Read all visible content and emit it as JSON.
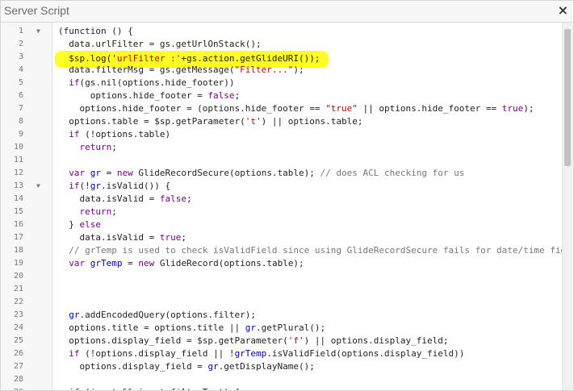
{
  "window": {
    "title": "Server Script",
    "close_icon": "×"
  },
  "lines": [
    {
      "n": "1",
      "fold": "▼",
      "segs": [
        [
          "",
          "(function () {"
        ]
      ]
    },
    {
      "n": "2",
      "fold": "",
      "segs": [
        [
          "",
          "  data.urlFilter = gs.getUrlOnStack();"
        ]
      ]
    },
    {
      "n": "3",
      "fold": "",
      "highlight": true,
      "segs": [
        [
          "",
          "  $sp.log("
        ],
        [
          "str",
          "'urlFilter :'"
        ],
        [
          "",
          "+gs.action.getGlideURI());"
        ]
      ]
    },
    {
      "n": "4",
      "fold": "",
      "segs": [
        [
          "",
          "  data.filterMsg = gs.getMessage("
        ],
        [
          "str",
          "\"Filter...\""
        ],
        [
          "",
          ");"
        ]
      ]
    },
    {
      "n": "5",
      "fold": "",
      "segs": [
        [
          "",
          "  "
        ],
        [
          "kw",
          "if"
        ],
        [
          "",
          "(gs.nil(options.hide_footer))"
        ]
      ]
    },
    {
      "n": "6",
      "fold": "",
      "segs": [
        [
          "",
          "      options.hide_footer = "
        ],
        [
          "kw",
          "false"
        ],
        [
          "",
          ";"
        ]
      ]
    },
    {
      "n": "7",
      "fold": "",
      "segs": [
        [
          "",
          "    options.hide_footer = (options.hide_footer == "
        ],
        [
          "str",
          "\"true\""
        ],
        [
          "",
          " || options.hide_footer == "
        ],
        [
          "kw",
          "true"
        ],
        [
          "",
          ");"
        ]
      ]
    },
    {
      "n": "8",
      "fold": "",
      "segs": [
        [
          "",
          "  options.table = $sp.getParameter("
        ],
        [
          "str",
          "'t'"
        ],
        [
          "",
          ") || options.table;"
        ]
      ]
    },
    {
      "n": "9",
      "fold": "",
      "segs": [
        [
          "",
          "  "
        ],
        [
          "kw",
          "if"
        ],
        [
          "",
          " (!options.table)"
        ]
      ]
    },
    {
      "n": "10",
      "fold": "",
      "segs": [
        [
          "",
          "    "
        ],
        [
          "kw",
          "return"
        ],
        [
          "",
          ";"
        ]
      ]
    },
    {
      "n": "11",
      "fold": "",
      "segs": [
        [
          "",
          ""
        ]
      ]
    },
    {
      "n": "12",
      "fold": "",
      "segs": [
        [
          "",
          "  "
        ],
        [
          "kw",
          "var"
        ],
        [
          "",
          " "
        ],
        [
          "vr",
          "gr"
        ],
        [
          "",
          " = "
        ],
        [
          "kw",
          "new"
        ],
        [
          "",
          " GlideRecordSecure(options.table); "
        ],
        [
          "cm",
          "// does ACL checking for us"
        ]
      ]
    },
    {
      "n": "13",
      "fold": "▼",
      "segs": [
        [
          "",
          "  "
        ],
        [
          "kw",
          "if"
        ],
        [
          "",
          "(!"
        ],
        [
          "vr",
          "gr"
        ],
        [
          "",
          ".isValid()) {"
        ]
      ]
    },
    {
      "n": "14",
      "fold": "",
      "segs": [
        [
          "",
          "    data.isValid = "
        ],
        [
          "kw",
          "false"
        ],
        [
          "",
          ";"
        ]
      ]
    },
    {
      "n": "15",
      "fold": "",
      "segs": [
        [
          "",
          "    "
        ],
        [
          "kw",
          "return"
        ],
        [
          "",
          ";"
        ]
      ]
    },
    {
      "n": "16",
      "fold": "",
      "segs": [
        [
          "",
          "  } "
        ],
        [
          "kw",
          "else"
        ]
      ]
    },
    {
      "n": "17",
      "fold": "",
      "segs": [
        [
          "",
          "    data.isValid = "
        ],
        [
          "kw",
          "true"
        ],
        [
          "",
          ";"
        ]
      ]
    },
    {
      "n": "18",
      "fold": "",
      "segs": [
        [
          "",
          "  "
        ],
        [
          "cm",
          "// grTemp is used to check isValidField since using GlideRecordSecure fails for date/time fie"
        ]
      ]
    },
    {
      "n": "19",
      "fold": "",
      "segs": [
        [
          "",
          "  "
        ],
        [
          "kw",
          "var"
        ],
        [
          "",
          " "
        ],
        [
          "vr",
          "grTemp"
        ],
        [
          "",
          " = "
        ],
        [
          "kw",
          "new"
        ],
        [
          "",
          " GlideRecord(options.table);"
        ]
      ]
    },
    {
      "n": "20",
      "fold": "",
      "segs": [
        [
          "",
          ""
        ]
      ]
    },
    {
      "n": "21",
      "fold": "",
      "segs": [
        [
          "",
          ""
        ]
      ]
    },
    {
      "n": "22",
      "fold": "",
      "segs": [
        [
          "",
          ""
        ]
      ]
    },
    {
      "n": "23",
      "fold": "",
      "segs": [
        [
          "",
          "  "
        ],
        [
          "vr",
          "gr"
        ],
        [
          "",
          ".addEncodedQuery(options.filter);"
        ]
      ]
    },
    {
      "n": "24",
      "fold": "",
      "segs": [
        [
          "",
          "  options.title = options.title || "
        ],
        [
          "vr",
          "gr"
        ],
        [
          "",
          ".getPlural();"
        ]
      ]
    },
    {
      "n": "25",
      "fold": "",
      "segs": [
        [
          "",
          "  options.display_field = $sp.getParameter("
        ],
        [
          "str",
          "'f'"
        ],
        [
          "",
          ") || options.display_field;"
        ]
      ]
    },
    {
      "n": "26",
      "fold": "",
      "segs": [
        [
          "",
          "  "
        ],
        [
          "kw",
          "if"
        ],
        [
          "",
          " (!options.display_field || !"
        ],
        [
          "vr",
          "grTemp"
        ],
        [
          "",
          ".isValidField(options.display_field))"
        ]
      ]
    },
    {
      "n": "27",
      "fold": "",
      "segs": [
        [
          "",
          "    options.display_field = "
        ],
        [
          "vr",
          "gr"
        ],
        [
          "",
          ".getDisplayName();"
        ]
      ]
    },
    {
      "n": "28",
      "fold": "",
      "segs": [
        [
          "",
          ""
        ]
      ]
    },
    {
      "n": "29",
      "fold": "",
      "segs": [
        [
          "",
          "  if (input && input.filterText) {"
        ]
      ]
    }
  ]
}
